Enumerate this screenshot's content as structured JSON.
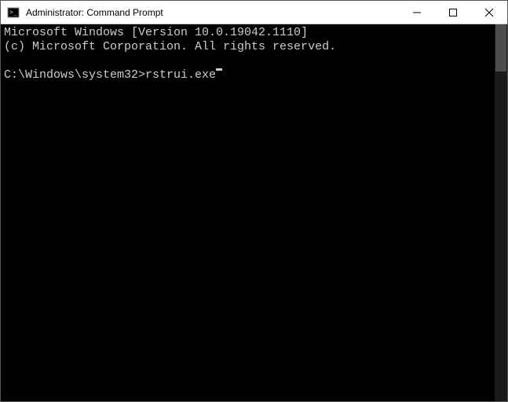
{
  "titlebar": {
    "title": "Administrator: Command Prompt"
  },
  "terminal": {
    "line1": "Microsoft Windows [Version 10.0.19042.1110]",
    "line2": "(c) Microsoft Corporation. All rights reserved.",
    "blank": "",
    "prompt": "C:\\Windows\\system32>",
    "command": "rstrui.exe"
  }
}
